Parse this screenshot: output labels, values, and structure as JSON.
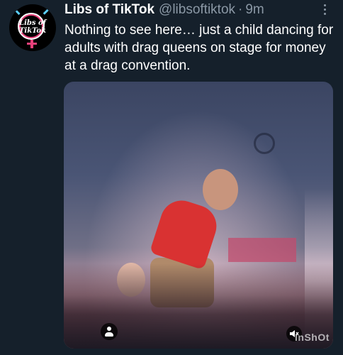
{
  "tweet": {
    "avatar": {
      "logo_text_line1": "Libs of",
      "logo_text_line2": "TikTok",
      "icon": "avatar-logo"
    },
    "author_name": "Libs of TikTok",
    "author_handle": "@libsoftiktok",
    "separator": "·",
    "time": "9m",
    "more_icon": "more-horizontal-icon",
    "text": "Nothing to see here… just a child dancing for adults with drag queens on stage for money at a drag convention.",
    "media": {
      "type": "video",
      "watermark": "InShOt",
      "user_icon": "tagged-user-icon",
      "sound_icon": "sound-muted-icon"
    }
  },
  "colors": {
    "background": "#15202b",
    "text_primary": "#ffffff",
    "text_secondary": "#8b98a5",
    "logo_pink": "#e8417a",
    "logo_blue": "#5bcefa"
  }
}
